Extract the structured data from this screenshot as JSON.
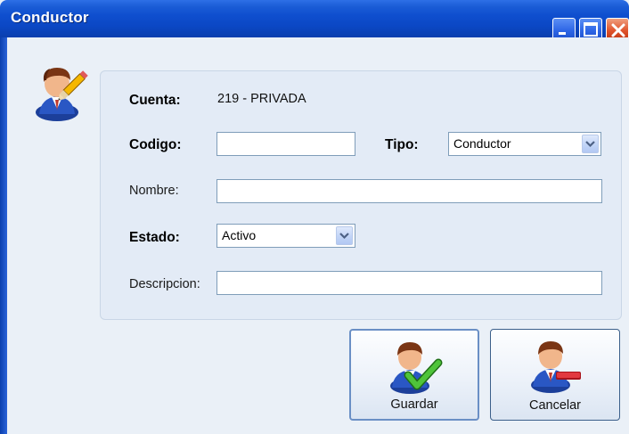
{
  "window": {
    "title": "Conductor"
  },
  "form": {
    "cuenta_label": "Cuenta:",
    "cuenta_value": "219 - PRIVADA",
    "codigo_label": "Codigo:",
    "codigo_value": "",
    "tipo_label": "Tipo:",
    "tipo_value": "Conductor",
    "nombre_label": "Nombre:",
    "nombre_value": "",
    "estado_label": "Estado:",
    "estado_value": "Activo",
    "descripcion_label": "Descripcion:",
    "descripcion_value": ""
  },
  "buttons": {
    "guardar": "Guardar",
    "cancelar": "Cancelar"
  },
  "colors": {
    "titlebar": "#0b47c4",
    "panel": "#e3ebf6",
    "client": "#eaf0f7",
    "close": "#e0552d",
    "check": "#3fae29",
    "minus": "#d8262b"
  },
  "icons": [
    "user-edit-icon",
    "user-check-icon",
    "user-remove-icon",
    "minimize-icon",
    "maximize-icon",
    "close-icon",
    "chevron-down-icon"
  ]
}
